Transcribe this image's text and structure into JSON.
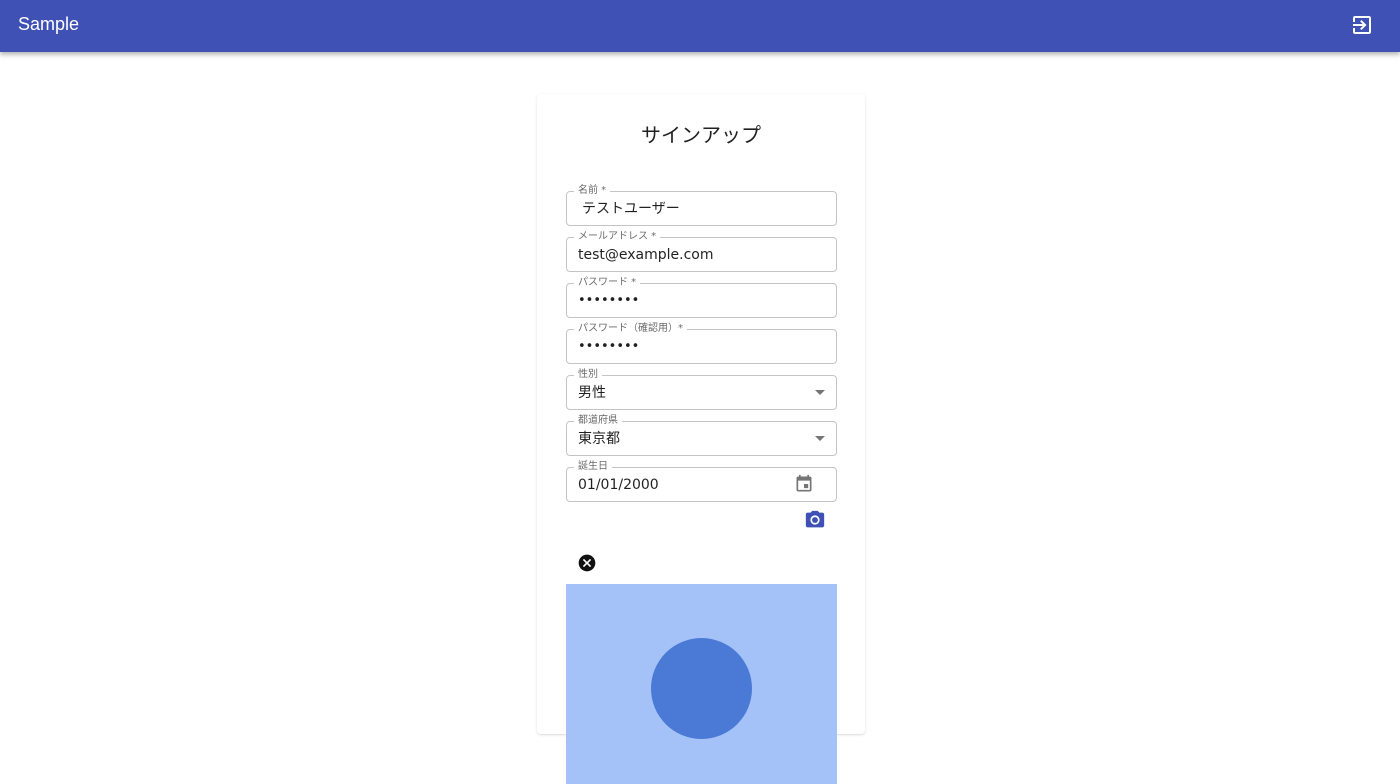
{
  "appbar": {
    "title": "Sample",
    "background": "#3f51b5",
    "logout_icon": "logout-icon"
  },
  "form": {
    "title": "サインアップ",
    "fields": [
      {
        "label": "名前 *",
        "value": "テストユーザー",
        "type": "text"
      },
      {
        "label": "メールアドレス *",
        "value": "test@example.com",
        "type": "email"
      },
      {
        "label": "パスワード *",
        "value": "••••••••",
        "type": "password"
      },
      {
        "label": "パスワード（確認用）*",
        "value": "••••••••",
        "type": "password"
      },
      {
        "label": "性別",
        "value": "男性",
        "type": "select"
      },
      {
        "label": "都道府県",
        "value": "東京都",
        "type": "select"
      },
      {
        "label": "誕生日",
        "value": "01/01/2000",
        "type": "date"
      }
    ],
    "camera_icon": "camera-icon",
    "clear_icon": "close-circle-icon",
    "accent": "#3f51b5",
    "preview": {
      "background": "#a4c2f7",
      "shape_color": "#4a7ad6"
    }
  }
}
